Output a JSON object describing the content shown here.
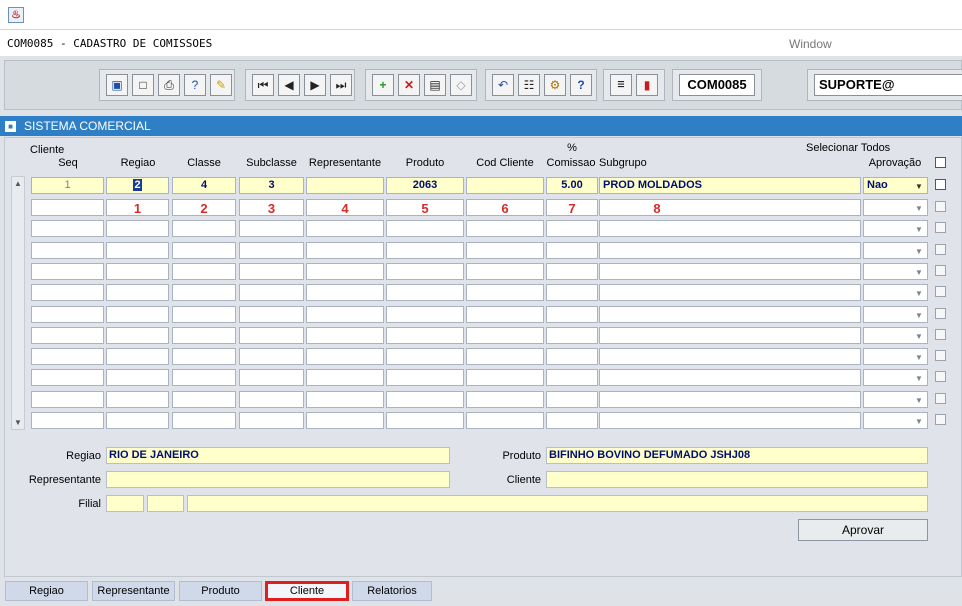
{
  "menu": {
    "form_title": "COM0085 - CADASTRO DE COMISSOES",
    "window": "Window"
  },
  "toolbar": {
    "form_code": "COM0085",
    "user": "SUPORTE@",
    "icons": [
      "save-icon",
      "window-icon",
      "print-icon",
      "help-query-icon",
      "edit-icon",
      "first-record-icon",
      "previous-record-icon",
      "next-record-icon",
      "last-record-icon",
      "insert-record-icon",
      "delete-record-icon",
      "view-record-icon",
      "clear-icon",
      "undo-icon",
      "clipboard-icon",
      "tools-icon",
      "help-icon",
      "menu-icon",
      "exit-icon"
    ]
  },
  "section": {
    "title": "SISTEMA COMERCIAL"
  },
  "grid": {
    "headers": {
      "cliente_seq_top": "Cliente",
      "cliente_seq": "Seq",
      "regiao": "Regiao",
      "classe": "Classe",
      "subclasse": "Subclasse",
      "representante": "Representante",
      "produto": "Produto",
      "cod_cliente": "Cod Cliente",
      "comissao_top": "%",
      "comissao": "Comissao",
      "subgrupo": "Subgrupo",
      "aprovacao_top": "Selecionar Todos",
      "aprovacao": "Aprovação"
    },
    "row1": {
      "seq": "1",
      "regiao": "2",
      "classe": "4",
      "subclasse": "3",
      "representante": "",
      "produto": "2063",
      "cod_cliente": "",
      "comissao": "5.00",
      "subgrupo": "PROD MOLDADOS",
      "aprovacao": "Nao"
    },
    "annotations": [
      "1",
      "2",
      "3",
      "4",
      "5",
      "6",
      "7",
      "8"
    ]
  },
  "details": {
    "regiao_label": "Regiao",
    "regiao_value": "RIO DE JANEIRO",
    "produto_label": "Produto",
    "produto_value": "BIFINHO BOVINO DEFUMADO JSHJ08",
    "representante_label": "Representante",
    "representante_value": "",
    "cliente_label": "Cliente",
    "cliente_value": "",
    "filial_label": "Filial"
  },
  "buttons": {
    "aprovar": "Aprovar"
  },
  "tabs": [
    {
      "label": "Regiao",
      "active": false
    },
    {
      "label": "Representante",
      "active": false
    },
    {
      "label": "Produto",
      "active": false
    },
    {
      "label": "Cliente",
      "active": true
    },
    {
      "label": "Relatorios",
      "active": false
    }
  ]
}
